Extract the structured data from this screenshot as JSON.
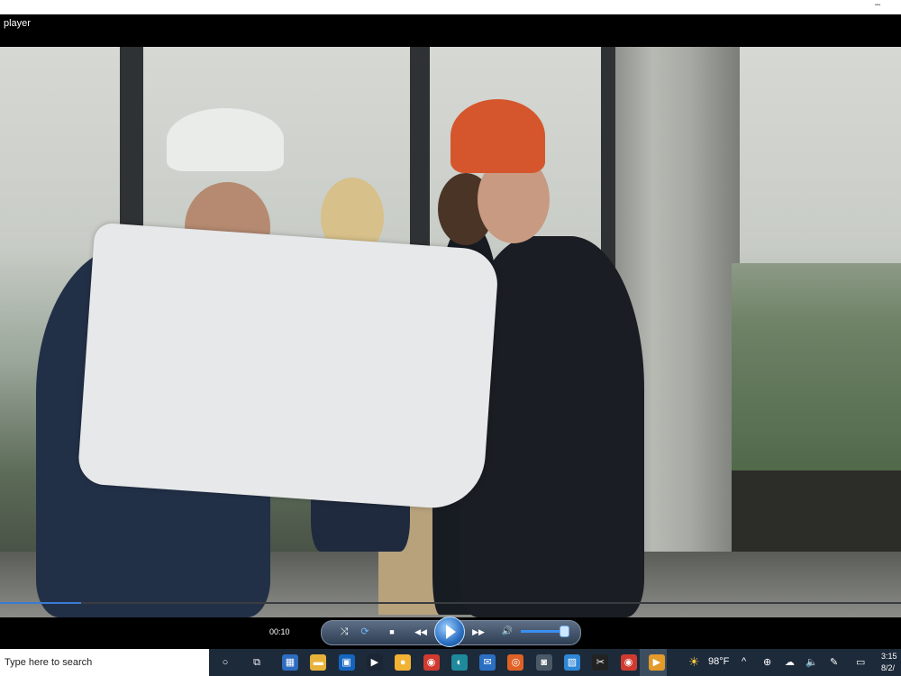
{
  "window": {
    "title": "player",
    "minimize_glyph": "–"
  },
  "video": {
    "progress_fraction": 0.09,
    "elapsed": "00:10"
  },
  "controls": {
    "shuffle_icon": "⤨",
    "repeat_icon": "⟳",
    "stop_icon": "■",
    "prev_icon": "◀◀",
    "next_icon": "▶▶",
    "volume_icon": "🔊",
    "volume_fraction": 0.95
  },
  "taskbar": {
    "search_placeholder": "Type here to search",
    "cortana_icon": "○",
    "taskview_icon": "⧉",
    "apps": [
      {
        "name": "calculator-app-icon",
        "glyph": "▦",
        "color": "#2d6cc0"
      },
      {
        "name": "file-explorer-app-icon",
        "glyph": "▬",
        "color": "#e8b23a"
      },
      {
        "name": "store-app-icon",
        "glyph": "▣",
        "color": "#1565c0"
      },
      {
        "name": "video-editor-app-icon",
        "glyph": "▶",
        "color": "#1b2533"
      },
      {
        "name": "color-app-icon",
        "glyph": "●",
        "color": "#f2b233"
      },
      {
        "name": "chrome-app-icon",
        "glyph": "◉",
        "color": "#d13b2f"
      },
      {
        "name": "edge-app-icon",
        "glyph": "◐",
        "color": "#1f8a9c"
      },
      {
        "name": "mail-app-icon",
        "glyph": "✉",
        "color": "#2b6fc2"
      },
      {
        "name": "record-app-icon",
        "glyph": "◎",
        "color": "#e06125"
      },
      {
        "name": "camera-app-icon",
        "glyph": "◙",
        "color": "#4a5966"
      },
      {
        "name": "photos-app-icon",
        "glyph": "▨",
        "color": "#2f86d6"
      },
      {
        "name": "snip-app-icon",
        "glyph": "✂",
        "color": "#222"
      },
      {
        "name": "chrome2-app-icon",
        "glyph": "◉",
        "color": "#d13b2f"
      },
      {
        "name": "media-player-app-icon",
        "glyph": "▶",
        "color": "#e29a2a"
      }
    ],
    "weather_icon": "☀",
    "temperature": "98°F",
    "chevron_icon": "^",
    "tray_icons": [
      "⊕",
      "☁",
      "🔈",
      "✎",
      "▭"
    ],
    "clock_time": "3:15",
    "clock_date": "8/2/"
  }
}
